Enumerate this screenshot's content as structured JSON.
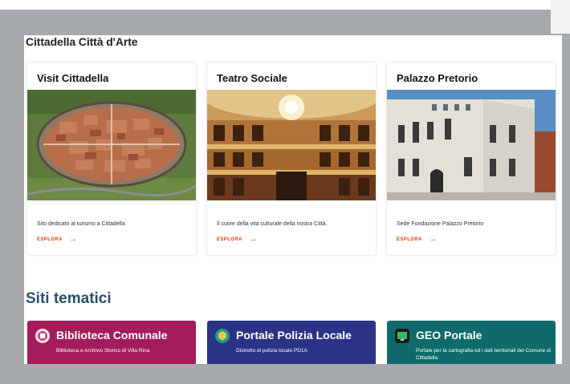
{
  "page": {
    "title": "Cittadella Città d'Arte"
  },
  "cards": [
    {
      "title": "Visit Cittadella",
      "description": "Sito dedicato al turismo a Cittadella",
      "link": "ESPLORA"
    },
    {
      "title": "Teatro Sociale",
      "description": "Il cuore della vita culturale della nostra Città.",
      "link": "ESPLORA"
    },
    {
      "title": "Palazzo Pretorio",
      "description": "Sede Fondazione Palazzo Pretorio",
      "link": "ESPLORA"
    }
  ],
  "themes_section": {
    "title": "Siti tematici"
  },
  "themes": [
    {
      "title": "Biblioteca Comunale",
      "description": "Biblioteca e Archivio Storico di Villa Rina",
      "color": "#a21d5a",
      "icon": "book-circle-icon"
    },
    {
      "title": "Portale Polizia Locale",
      "description": "Distretto di polizia locale PD1A",
      "color": "#2b3386",
      "icon": "police-badge-icon"
    },
    {
      "title": "GEO Portale",
      "description": "Portale per la cartografia ed i dati territoriali del Comune di Cittadella",
      "color": "#0f6b6b",
      "icon": "map-screen-icon"
    }
  ]
}
